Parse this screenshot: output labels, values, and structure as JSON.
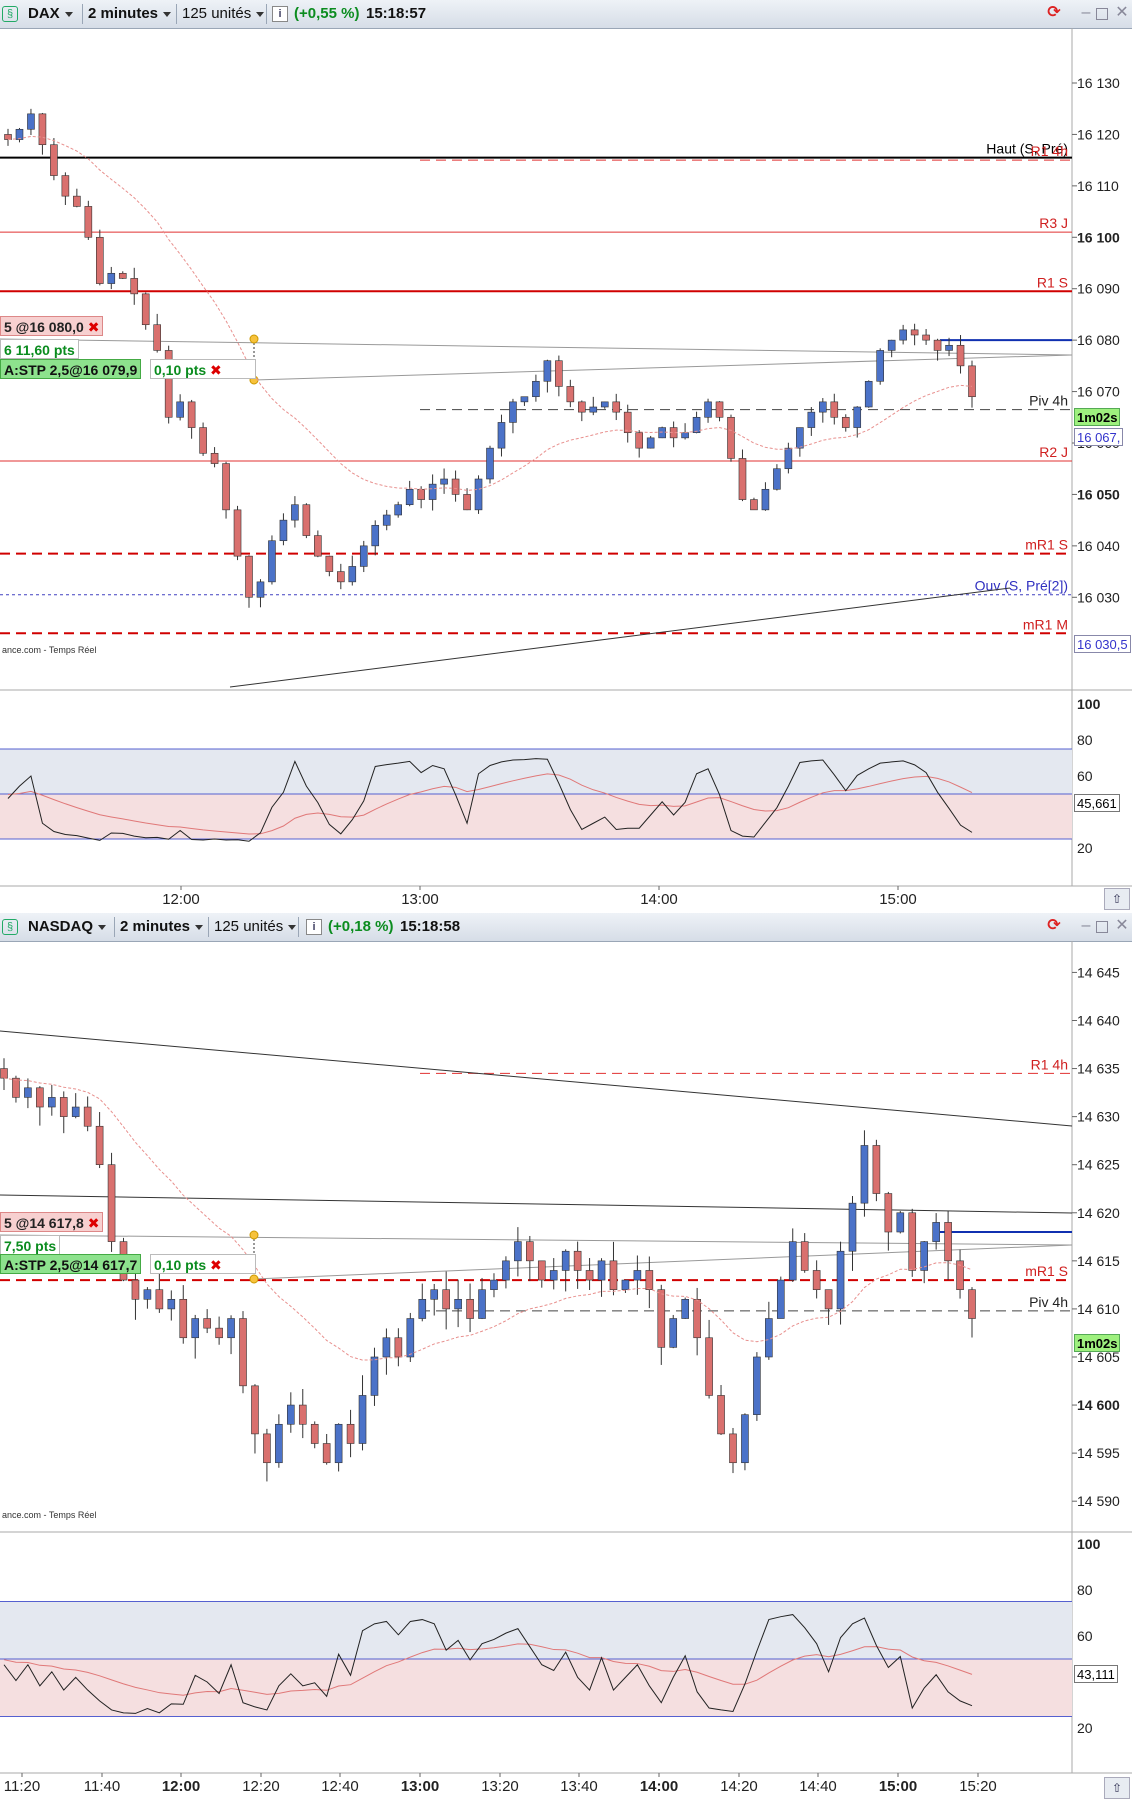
{
  "panels": [
    {
      "toolbar": {
        "instrument": "DAX",
        "timeframe": "2 minutes",
        "units": "125 unités",
        "change": "(+0,55 %)",
        "time": "15:18:57"
      },
      "y_labels": [
        "16 130",
        "16 120",
        "16 110",
        "16 100",
        "16 090",
        "16 080",
        "16 070",
        "16 060",
        "16 050",
        "16 040",
        "16 030"
      ],
      "y_bold": [
        "16 100",
        "16 050"
      ],
      "ind_labels": [
        "100",
        "80",
        "60",
        "40",
        "20"
      ],
      "x_labels": [
        "12:00",
        "13:00",
        "14:00",
        "15:00"
      ],
      "level_labels": [
        "Haut (S, Pré)",
        "R1 4h",
        "R3 J",
        "R1 S",
        "Piv 4h",
        "R2 J",
        "mR1 S",
        "Ouv (S, Pré[2])",
        "mR1 M"
      ],
      "tags": {
        "current": "1m02s",
        "price": "16 067,",
        "ind_value": "45,661",
        "open_tag": "16 030,5"
      },
      "orders": {
        "stop_price": "5 @16 080,0",
        "qty_pts": "6 11,60 pts",
        "stop_label": "A:STP 2,5@16 079,9",
        "step": "0,10 pts"
      },
      "footer": "ance.com - Temps Réel"
    },
    {
      "toolbar": {
        "instrument": "NASDAQ",
        "timeframe": "2 minutes",
        "units": "125 unités",
        "change": "(+0,18 %)",
        "time": "15:18:58"
      },
      "y_labels": [
        "14 645",
        "14 640",
        "14 635",
        "14 630",
        "14 625",
        "14 620",
        "14 615",
        "14 610",
        "14 605",
        "14 600",
        "14 595",
        "14 590"
      ],
      "y_bold": [
        "14 600"
      ],
      "ind_labels": [
        "100",
        "80",
        "60",
        "40",
        "20"
      ],
      "x_labels": [
        "11:20",
        "11:40",
        "12:00",
        "12:20",
        "12:40",
        "13:00",
        "13:20",
        "13:40",
        "14:00",
        "14:20",
        "14:40",
        "15:00",
        "15:20"
      ],
      "x_bold": [
        "12:00",
        "13:00",
        "14:00",
        "15:00"
      ],
      "level_labels": [
        "R1 4h",
        "mR1 S",
        "Piv 4h"
      ],
      "tags": {
        "current": "1m02s",
        "ind_value": "43,111"
      },
      "orders": {
        "stop_price": "5 @14 617,8",
        "qty_pts": "7,50 pts",
        "stop_label": "A:STP 2,5@14 617,7",
        "step": "0,10 pts"
      },
      "footer": "ance.com - Temps Réel"
    }
  ],
  "chart_data": [
    {
      "type": "candlestick",
      "title": "DAX",
      "x_ticks": [
        "12:00",
        "13:00",
        "14:00",
        "15:00"
      ],
      "ylim": [
        16023,
        16133
      ],
      "close_path": [
        16119,
        16121,
        16124,
        16118,
        16112,
        16108,
        16106,
        16100,
        16091,
        16093,
        16092,
        16089,
        16083,
        16078,
        16065,
        16068,
        16063,
        16058,
        16056,
        16047,
        16038,
        16030,
        16033,
        16041,
        16045,
        16048,
        16042,
        16038,
        16035,
        16033,
        16036,
        16040,
        16044,
        16046,
        16048,
        16051,
        16049,
        16052,
        16053,
        16050,
        16047,
        16053,
        16059,
        16064,
        16068,
        16069,
        16072,
        16076,
        16071,
        16068,
        16066,
        16067,
        16068,
        16066,
        16062,
        16059,
        16061,
        16063,
        16061,
        16062,
        16065,
        16068,
        16065,
        16057,
        16049,
        16047,
        16051,
        16055,
        16059,
        16063,
        16066,
        16068,
        16065,
        16063,
        16067,
        16072,
        16078,
        16080,
        16082,
        16081,
        16080,
        16078,
        16079,
        16075,
        16069
      ],
      "hlines": [
        {
          "name": "Haut (S, Pré)",
          "value": 16115.5,
          "color": "#000000",
          "style": "solid"
        },
        {
          "name": "R1 4h",
          "value": 16115,
          "color": "#e03030",
          "style": "dashed"
        },
        {
          "name": "R3 J",
          "value": 16101,
          "color": "#e03030",
          "style": "solid"
        },
        {
          "name": "R1 S",
          "value": 16089.5,
          "color": "#d00000",
          "style": "solid"
        },
        {
          "name": "Piv 4h",
          "value": 16066.5,
          "color": "#444444",
          "style": "dashed"
        },
        {
          "name": "R2 J",
          "value": 16056.5,
          "color": "#e03030",
          "style": "solid"
        },
        {
          "name": "mR1 S",
          "value": 16038.5,
          "color": "#d00000",
          "style": "dashed"
        },
        {
          "name": "Ouv (S, Pré[2])",
          "value": 16030.5,
          "color": "#4040c0",
          "style": "dotted"
        },
        {
          "name": "mR1 M",
          "value": 16023,
          "color": "#d00000",
          "style": "dashed"
        }
      ],
      "stop_level": 16080,
      "indicator": {
        "ylim": [
          0,
          100
        ],
        "bands": [
          25,
          50,
          75
        ],
        "last": 45.661
      }
    },
    {
      "type": "candlestick",
      "title": "NASDAQ",
      "x_ticks": [
        "11:20",
        "11:40",
        "12:00",
        "12:20",
        "12:40",
        "13:00",
        "13:20",
        "13:40",
        "14:00",
        "14:20",
        "14:40",
        "15:00",
        "15:20"
      ],
      "ylim": [
        14589,
        14645
      ],
      "close_path": [
        14634,
        14632,
        14633,
        14631,
        14632,
        14630,
        14631,
        14629,
        14625,
        14617,
        14613,
        14611,
        14612,
        14610,
        14611,
        14607,
        14609,
        14608,
        14607,
        14609,
        14602,
        14597,
        14594,
        14598,
        14600,
        14598,
        14596,
        14594,
        14598,
        14596,
        14601,
        14605,
        14607,
        14605,
        14609,
        14611,
        14612,
        14610,
        14611,
        14609,
        14612,
        14613,
        14615,
        14617,
        14615,
        14613,
        14614,
        14616,
        14614,
        14613,
        14615,
        14612,
        14613,
        14614,
        14612,
        14606,
        14609,
        14611,
        14607,
        14601,
        14597,
        14594,
        14599,
        14605,
        14609,
        14613,
        14617,
        14614,
        14612,
        14610,
        14616,
        14621,
        14627,
        14622,
        14618,
        14620,
        14614,
        14617,
        14619,
        14615,
        14612,
        14609
      ],
      "hlines": [
        {
          "name": "R1 4h",
          "value": 14634.5,
          "color": "#e03030",
          "style": "dashed"
        },
        {
          "name": "mR1 S",
          "value": 14613,
          "color": "#d00000",
          "style": "dashed"
        },
        {
          "name": "Piv 4h",
          "value": 14609.8,
          "color": "#444444",
          "style": "dashed"
        }
      ],
      "stop_level": 14618,
      "indicator": {
        "ylim": [
          0,
          100
        ],
        "bands": [
          25,
          50,
          75
        ],
        "last": 43.111
      }
    }
  ]
}
